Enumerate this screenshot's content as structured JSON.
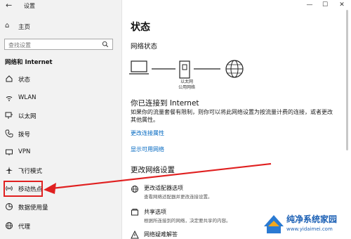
{
  "app": {
    "title": "设置",
    "back": "←"
  },
  "window": {
    "minimize": "—",
    "maximize": "☐",
    "close": "✕"
  },
  "sidebar": {
    "home": "主页",
    "search_placeholder": "查找设置",
    "section_title": "网络和 Internet",
    "items": [
      {
        "label": "状态",
        "icon": "home-status-icon"
      },
      {
        "label": "WLAN",
        "icon": "wifi-icon"
      },
      {
        "label": "以太网",
        "icon": "ethernet-icon"
      },
      {
        "label": "拨号",
        "icon": "phone-icon"
      },
      {
        "label": "VPN",
        "icon": "vpn-icon"
      },
      {
        "label": "飞行模式",
        "icon": "airplane-icon"
      },
      {
        "label": "移动热点",
        "icon": "hotspot-icon"
      },
      {
        "label": "数据使用量",
        "icon": "data-usage-icon"
      },
      {
        "label": "代理",
        "icon": "globe-icon"
      }
    ],
    "highlighted_item": "移动热点"
  },
  "main": {
    "title": "状态",
    "network_status_heading": "网络状态",
    "network_label_line1": "以太网",
    "network_label_line2": "公用网络",
    "connected_title": "你已连接到 Internet",
    "connected_desc": "如果你的流量套餐有限制，则你可以将此网络设置为按流量计费的连接，或者更改其他属性。",
    "link_change_props": "更改连接属性",
    "link_show_networks": "显示可用网络",
    "change_settings_heading": "更改网络设置",
    "options": [
      {
        "title": "更改适配器选项",
        "desc": "查看网络适配器并更改连接设置。",
        "icon": "adapter-icon"
      },
      {
        "title": "共享选项",
        "desc": "根据所连接到的网络，决定要共享的内容。",
        "icon": "share-icon"
      },
      {
        "title": "网络疑难解答",
        "desc": "",
        "icon": "warning-icon"
      }
    ]
  },
  "watermark": {
    "name": "纯净系统家园",
    "url": "www.yidaimei.com"
  },
  "colors": {
    "sidebar_bg": "#f2f2f2",
    "link": "#0067c0",
    "highlight": "#e02020",
    "arrow": "#e02020"
  }
}
